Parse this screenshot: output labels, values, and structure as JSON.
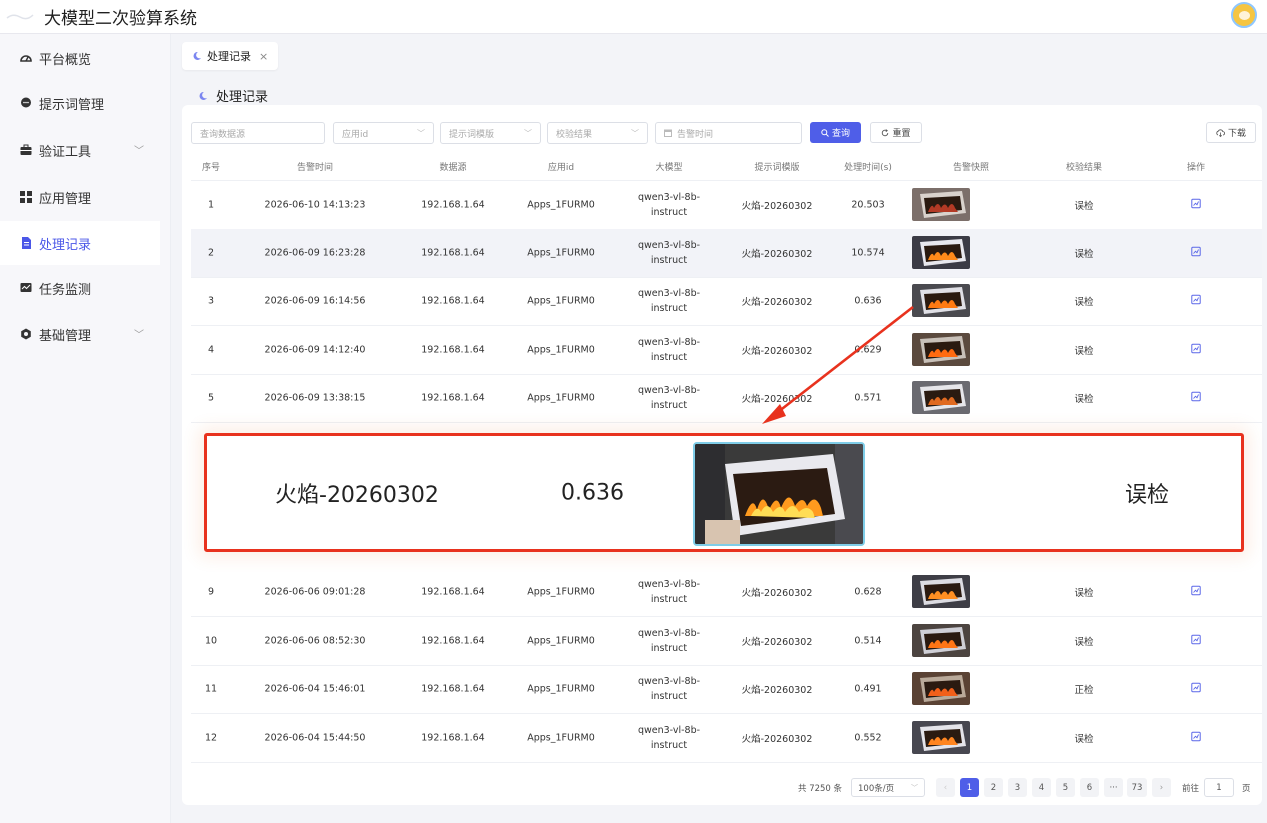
{
  "header": {
    "title": "大模型二次验算系统"
  },
  "sidebar": {
    "items": [
      {
        "label": "平台概览",
        "icon": "dashboard-icon"
      },
      {
        "label": "提示词管理",
        "icon": "chat-bubble-icon"
      },
      {
        "label": "验证工具",
        "icon": "toolbox-icon",
        "expandable": true
      },
      {
        "label": "应用管理",
        "icon": "grid-icon"
      },
      {
        "label": "处理记录",
        "icon": "document-icon",
        "active": true
      },
      {
        "label": "任务监测",
        "icon": "monitor-icon"
      },
      {
        "label": "基础管理",
        "icon": "settings-icon",
        "expandable": true
      }
    ]
  },
  "tabs": [
    {
      "label": "处理记录",
      "close": "×"
    }
  ],
  "page_title": "处理记录",
  "filters": {
    "search_placeholder": "查询数据源",
    "app_placeholder": "应用id",
    "template_placeholder": "提示词模版",
    "result_placeholder": "校验结果",
    "time_placeholder": "告警时间",
    "query_label": "查询",
    "reset_label": "重置",
    "download_label": "下载"
  },
  "table": {
    "columns": [
      "序号",
      "告警时间",
      "数据源",
      "应用id",
      "大模型",
      "提示词模版",
      "处理时间(s)",
      "告警快照",
      "校验结果",
      "操作"
    ],
    "rows": [
      {
        "no": "1",
        "time": "2026-06-10 14:13:23",
        "source": "192.168.1.64",
        "app": "Apps_1FURM0",
        "model1": "qwen3-vl-8b-",
        "model2": "instruct",
        "template": "火焰-20260302",
        "duration": "20.503",
        "result": "误检"
      },
      {
        "no": "2",
        "time": "2026-06-09 16:23:28",
        "source": "192.168.1.64",
        "app": "Apps_1FURM0",
        "model1": "qwen3-vl-8b-",
        "model2": "instruct",
        "template": "火焰-20260302",
        "duration": "10.574",
        "result": "误检"
      },
      {
        "no": "3",
        "time": "2026-06-09 16:14:56",
        "source": "192.168.1.64",
        "app": "Apps_1FURM0",
        "model1": "qwen3-vl-8b-",
        "model2": "instruct",
        "template": "火焰-20260302",
        "duration": "0.636",
        "result": "误检"
      },
      {
        "no": "4",
        "time": "2026-06-09 14:12:40",
        "source": "192.168.1.64",
        "app": "Apps_1FURM0",
        "model1": "qwen3-vl-8b-",
        "model2": "instruct",
        "template": "火焰-20260302",
        "duration": "0.629",
        "result": "误检"
      },
      {
        "no": "5",
        "time": "2026-06-09 13:38:15",
        "source": "192.168.1.64",
        "app": "Apps_1FURM0",
        "model1": "qwen3-vl-8b-",
        "model2": "instruct",
        "template": "火焰-20260302",
        "duration": "0.571",
        "result": "误检"
      },
      {
        "no": "9",
        "time": "2026-06-06 09:01:28",
        "source": "192.168.1.64",
        "app": "Apps_1FURM0",
        "model1": "qwen3-vl-8b-",
        "model2": "instruct",
        "template": "火焰-20260302",
        "duration": "0.628",
        "result": "误检"
      },
      {
        "no": "10",
        "time": "2026-06-06 08:52:30",
        "source": "192.168.1.64",
        "app": "Apps_1FURM0",
        "model1": "qwen3-vl-8b-",
        "model2": "instruct",
        "template": "火焰-20260302",
        "duration": "0.514",
        "result": "误检"
      },
      {
        "no": "11",
        "time": "2026-06-04 15:46:01",
        "source": "192.168.1.64",
        "app": "Apps_1FURM0",
        "model1": "qwen3-vl-8b-",
        "model2": "instruct",
        "template": "火焰-20260302",
        "duration": "0.491",
        "result": "正检"
      },
      {
        "no": "12",
        "time": "2026-06-04 15:44:50",
        "source": "192.168.1.64",
        "app": "Apps_1FURM0",
        "model1": "qwen3-vl-8b-",
        "model2": "instruct",
        "template": "火焰-20260302",
        "duration": "0.552",
        "result": "误检"
      }
    ]
  },
  "zoom": {
    "template": "火焰-20260302",
    "duration": "0.636",
    "result": "误检"
  },
  "pagination": {
    "total": "共 7250 条",
    "page_size": "100条/页",
    "prev": "‹",
    "pages": [
      "1",
      "2",
      "3",
      "4",
      "5",
      "6",
      "···",
      "73"
    ],
    "next": "›",
    "goto_label": "前往",
    "goto_value": "1",
    "page_suffix": "页"
  },
  "colors": {
    "accent": "#4f5ee8",
    "highlight": "#e8321e"
  }
}
